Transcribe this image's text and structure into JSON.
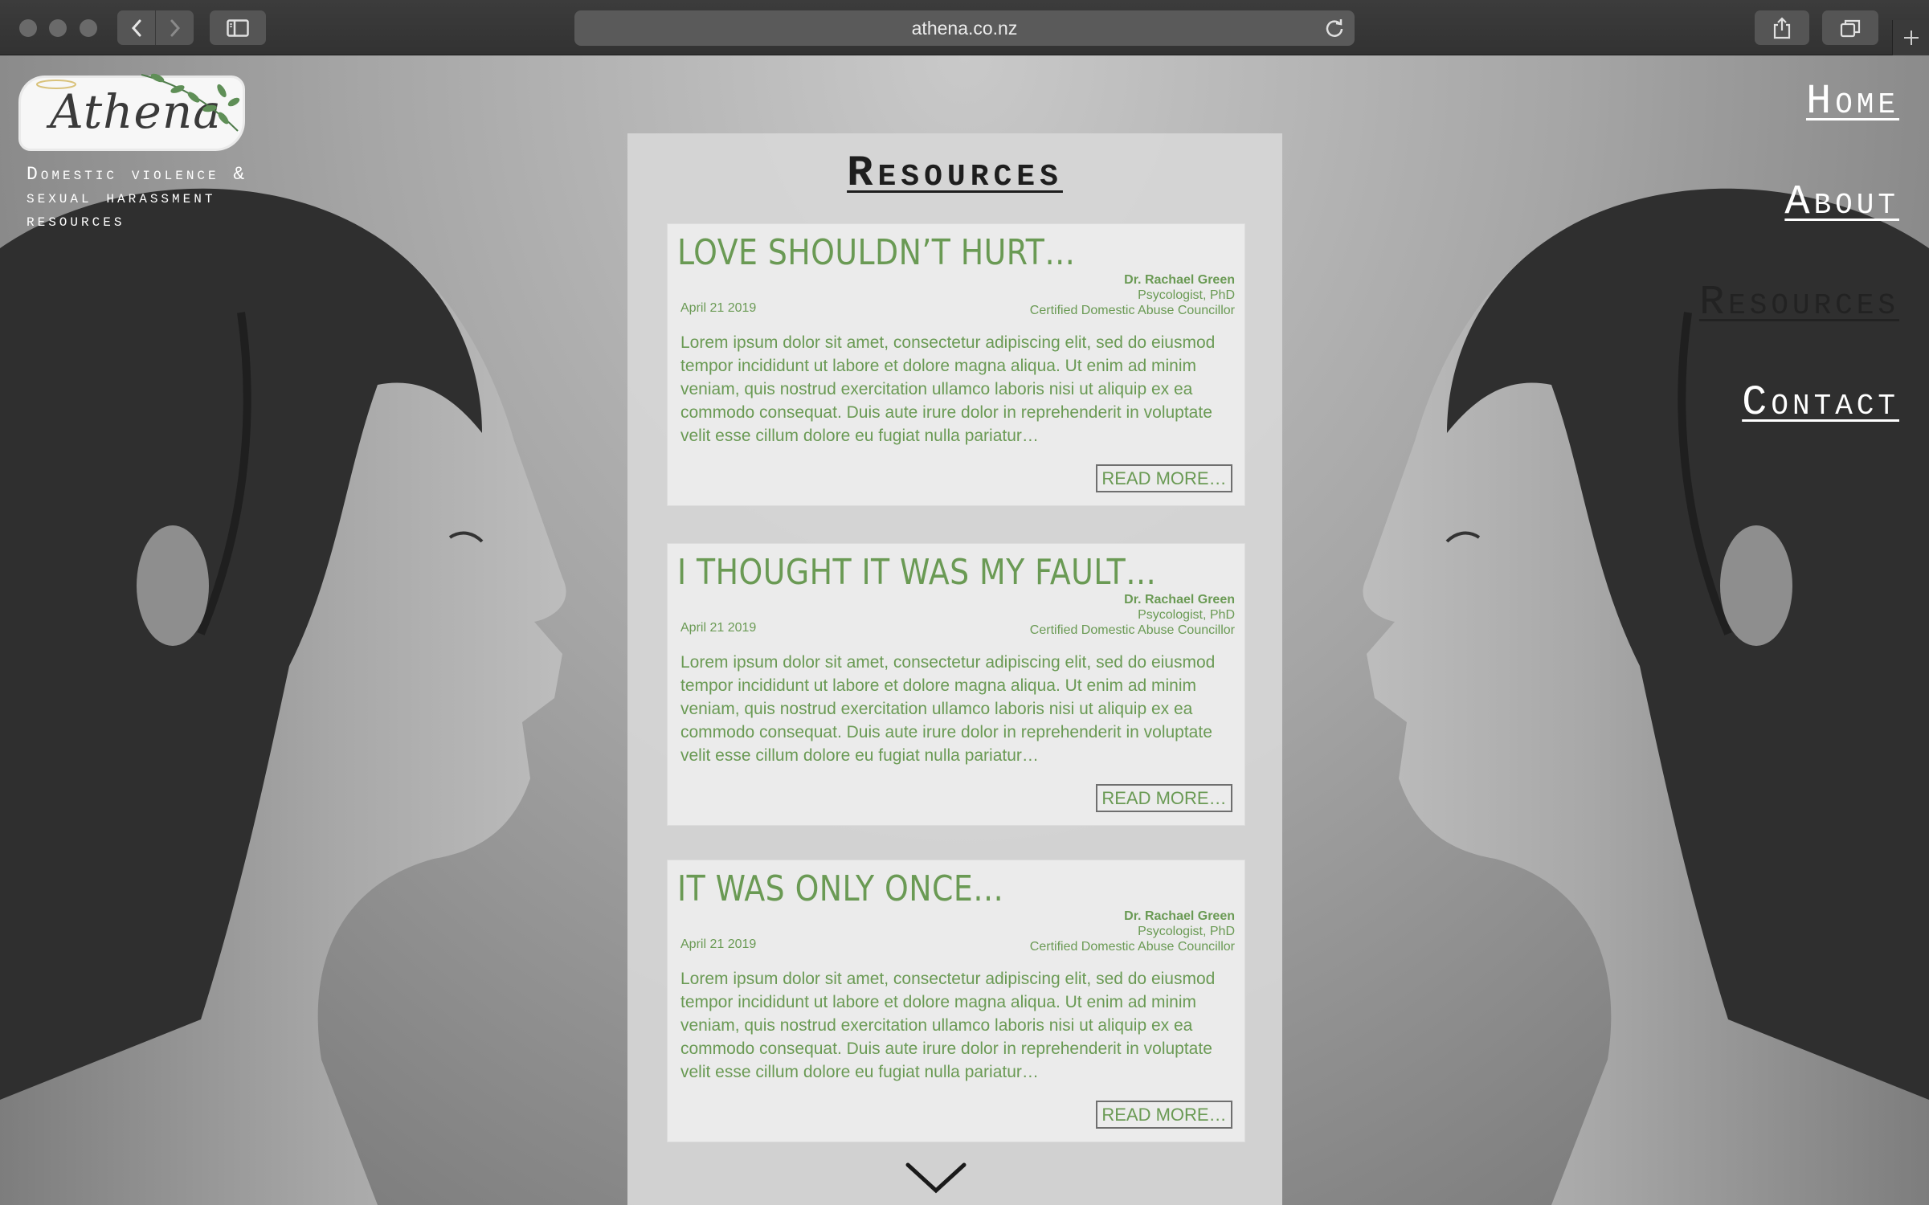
{
  "browser": {
    "url": "athena.co.nz"
  },
  "site": {
    "logo_text": "Athena",
    "tagline": "Domestic violence & sexual harassment resources"
  },
  "nav": {
    "items": [
      {
        "label": "Home"
      },
      {
        "label": "About"
      },
      {
        "label": "Resources"
      },
      {
        "label": "Contact"
      }
    ]
  },
  "resources": {
    "title": "Resources",
    "articles": [
      {
        "title": "LOVE SHOULDN’T HURT…",
        "author_name": "Dr. Rachael Green",
        "author_title": "Psycologist, PhD",
        "author_cert": "Certified Domestic Abuse Councillor",
        "date": "April 21 2019",
        "excerpt": "Lorem ipsum dolor sit amet, consectetur adipiscing elit, sed do eiusmod tempor incididunt ut labore et dolore magna aliqua. Ut enim ad minim veniam, quis nostrud exercitation ullamco laboris nisi ut aliquip ex ea commodo consequat. Duis aute irure dolor in reprehenderit in voluptate velit esse cillum dolore eu fugiat nulla pariatur…",
        "read_more": "READ MORE…"
      },
      {
        "title": "I THOUGHT IT WAS MY FAULT…",
        "author_name": "Dr. Rachael Green",
        "author_title": "Psycologist, PhD",
        "author_cert": "Certified Domestic Abuse Councillor",
        "date": "April 21 2019",
        "excerpt": "Lorem ipsum dolor sit amet, consectetur adipiscing elit, sed do eiusmod tempor incididunt ut labore et dolore magna aliqua. Ut enim ad minim veniam, quis nostrud exercitation ullamco laboris nisi ut aliquip ex ea commodo consequat. Duis aute irure dolor in reprehenderit in voluptate velit esse cillum dolore eu fugiat nulla pariatur…",
        "read_more": "READ MORE…"
      },
      {
        "title": "IT WAS ONLY ONCE…",
        "author_name": "Dr. Rachael Green",
        "author_title": "Psycologist, PhD",
        "author_cert": "Certified Domestic Abuse Councillor",
        "date": "April 21 2019",
        "excerpt": "Lorem ipsum dolor sit amet, consectetur adipiscing elit, sed do eiusmod tempor incididunt ut labore et dolore magna aliqua. Ut enim ad minim veniam, quis nostrud exercitation ullamco laboris nisi ut aliquip ex ea commodo consequat. Duis aute irure dolor in reprehenderit in voluptate velit esse cillum dolore eu fugiat nulla pariatur…",
        "read_more": "READ MORE…"
      }
    ]
  },
  "icons": {
    "back": "chevron-left-icon",
    "forward": "chevron-right-icon",
    "sidebar": "sidebar-icon",
    "reload": "reload-icon",
    "share": "share-icon",
    "tabs": "tabs-icon",
    "new_tab": "plus-icon",
    "scroll_down": "chevron-down-icon",
    "logo_leaves": "olive-branch-icon"
  },
  "colors": {
    "accent_green": "#6a9a54",
    "nav_text": "#ffffff",
    "nav_active": "#222222"
  }
}
